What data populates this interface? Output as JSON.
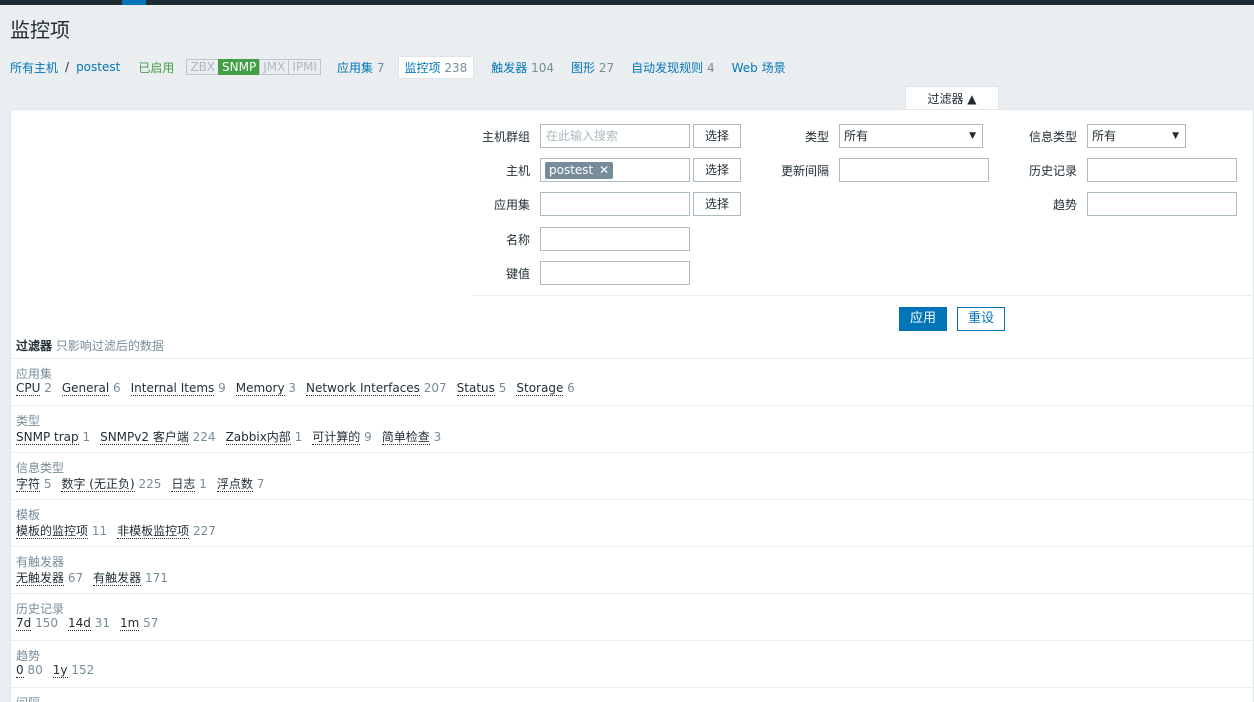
{
  "page_title": "监控项",
  "nav": {
    "all_hosts": "所有主机",
    "separator": "/",
    "host": "postest",
    "status": "已启用",
    "interfaces": [
      {
        "label": "ZBX",
        "active": false
      },
      {
        "label": "SNMP",
        "active": true
      },
      {
        "label": "JMX",
        "active": false
      },
      {
        "label": "IPMI",
        "active": false
      }
    ],
    "links": [
      {
        "label": "应用集",
        "count": "7"
      },
      {
        "label": "监控项",
        "count": "238"
      },
      {
        "label": "触发器",
        "count": "104"
      },
      {
        "label": "图形",
        "count": "27"
      },
      {
        "label": "自动发现规则",
        "count": "4"
      },
      {
        "label": "Web 场景",
        "count": ""
      }
    ]
  },
  "filter": {
    "tab_label": "过滤器 ▲",
    "host_group_label": "主机群组",
    "host_group_placeholder": "在此输入搜索",
    "host_label": "主机",
    "host_tag": "postest",
    "application_label": "应用集",
    "name_label": "名称",
    "key_label": "键值",
    "select_label": "选择",
    "type_label": "类型",
    "type_value": "所有",
    "interval_label": "更新间隔",
    "info_type_label": "信息类型",
    "info_type_value": "所有",
    "history_label": "历史记录",
    "trends_label": "趋势",
    "apply_label": "应用",
    "reset_label": "重设"
  },
  "subfilter": {
    "title": "过滤器",
    "note": "只影响过滤后的数据",
    "groups": [
      {
        "title": "应用集",
        "items": [
          {
            "label": "CPU",
            "count": "2"
          },
          {
            "label": "General",
            "count": "6"
          },
          {
            "label": "Internal Items",
            "count": "9"
          },
          {
            "label": "Memory",
            "count": "3"
          },
          {
            "label": "Network Interfaces",
            "count": "207"
          },
          {
            "label": "Status",
            "count": "5"
          },
          {
            "label": "Storage",
            "count": "6"
          }
        ]
      },
      {
        "title": "类型",
        "items": [
          {
            "label": "SNMP trap",
            "count": "1"
          },
          {
            "label": "SNMPv2 客户端",
            "count": "224"
          },
          {
            "label": "Zabbix内部",
            "count": "1"
          },
          {
            "label": "可计算的",
            "count": "9"
          },
          {
            "label": "简单检查",
            "count": "3"
          }
        ]
      },
      {
        "title": "信息类型",
        "items": [
          {
            "label": "字符",
            "count": "5"
          },
          {
            "label": "数字 (无正负)",
            "count": "225"
          },
          {
            "label": "日志",
            "count": "1"
          },
          {
            "label": "浮点数",
            "count": "7"
          }
        ]
      },
      {
        "title": "模板",
        "items": [
          {
            "label": "模板的监控项",
            "count": "11"
          },
          {
            "label": "非模板监控项",
            "count": "227"
          }
        ]
      },
      {
        "title": "有触发器",
        "items": [
          {
            "label": "无触发器",
            "count": "67"
          },
          {
            "label": "有触发器",
            "count": "171"
          }
        ]
      },
      {
        "title": "历史记录",
        "items": [
          {
            "label": "7d",
            "count": "150"
          },
          {
            "label": "14d",
            "count": "31"
          },
          {
            "label": "1m",
            "count": "57"
          }
        ]
      },
      {
        "title": "趋势",
        "items": [
          {
            "label": "0",
            "count": "80"
          },
          {
            "label": "1y",
            "count": "152"
          }
        ]
      },
      {
        "title": "间隔",
        "items": []
      }
    ]
  }
}
